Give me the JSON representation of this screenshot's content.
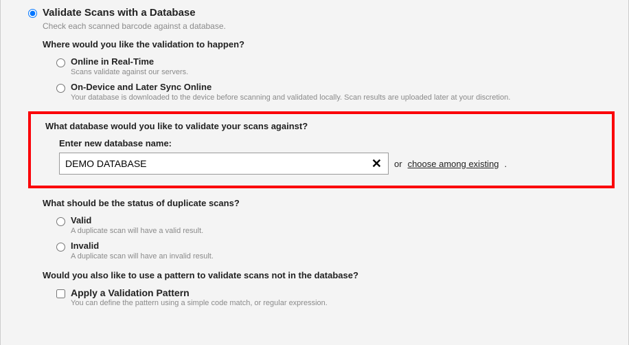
{
  "main_option": {
    "title": "Validate Scans with a Database",
    "desc": "Check each scanned barcode against a database."
  },
  "validation_location": {
    "question": "Where would you like the validation to happen?",
    "options": [
      {
        "title": "Online in Real-Time",
        "desc": "Scans validate against our servers."
      },
      {
        "title": "On-Device and Later Sync Online",
        "desc": "Your database is downloaded to the device before scanning and validated locally. Scan results are uploaded later at your discretion."
      }
    ]
  },
  "database_choice": {
    "question": "What database would you like to validate your scans against?",
    "label": "Enter new database name:",
    "input_value": "DEMO DATABASE",
    "or": "or",
    "link": "choose among existing",
    "period": "."
  },
  "duplicate_status": {
    "question": "What should be the status of duplicate scans?",
    "options": [
      {
        "title": "Valid",
        "desc": "A duplicate scan will have a valid result."
      },
      {
        "title": "Invalid",
        "desc": "A duplicate scan will have an invalid result."
      }
    ]
  },
  "pattern": {
    "question": "Would you also like to use a pattern to validate scans not in the database?",
    "title": "Apply a Validation Pattern",
    "desc": "You can define the pattern using a simple code match, or regular expression."
  }
}
